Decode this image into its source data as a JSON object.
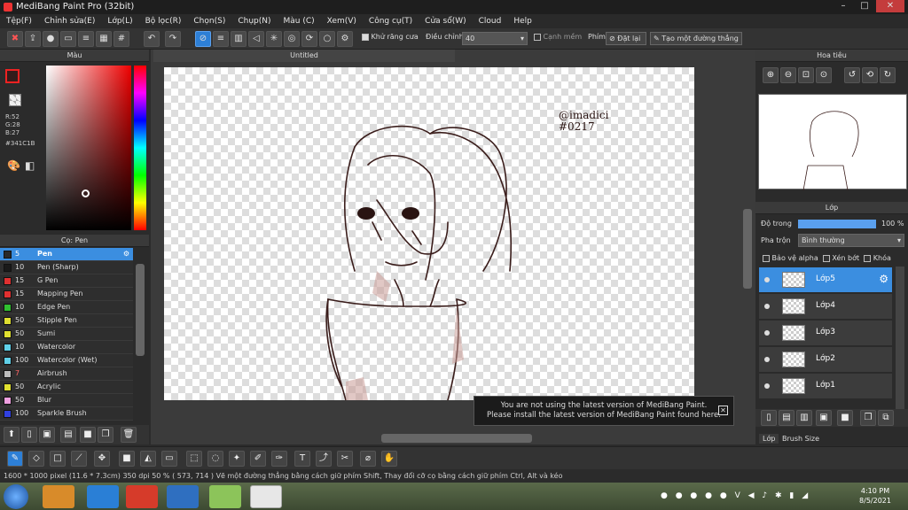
{
  "window": {
    "title": "MediBang Paint Pro (32bit)",
    "min": "–",
    "max": "□",
    "close": "✕"
  },
  "menu": [
    "Tệp(F)",
    "Chỉnh sửa(E)",
    "Lớp(L)",
    "Bộ lọc(R)",
    "Chọn(S)",
    "Chụp(N)",
    "Màu (C)",
    "Xem(V)",
    "Công cụ(T)",
    "Cửa sổ(W)",
    "Cloud",
    "Help"
  ],
  "toolbar": {
    "antialias_label": "Khử răng cưa",
    "adjust_label": "Điều chỉnh",
    "adjust_value": "40",
    "edge_label": "Cạnh mềm",
    "key_label": "Phím",
    "reset_label": "Đặt lại",
    "straight_label": "Tạo một đường thẳng"
  },
  "color_panel": {
    "title": "Màu",
    "r": "R:52",
    "g": "G:28",
    "b": "B:27",
    "hex": "#341C1B",
    "main_color": "#341C1B"
  },
  "brush_panel": {
    "title": "Cọ: Pen",
    "brushes": [
      {
        "size": "5",
        "name": "Pen",
        "color": "#2a2a2a",
        "selected": true
      },
      {
        "size": "10",
        "name": "Pen (Sharp)",
        "color": "#1a1a1a"
      },
      {
        "size": "15",
        "name": "G Pen",
        "color": "#e03030"
      },
      {
        "size": "15",
        "name": "Mapping Pen",
        "color": "#e03030"
      },
      {
        "size": "10",
        "name": "Edge Pen",
        "color": "#30c030"
      },
      {
        "size": "50",
        "name": "Stipple Pen",
        "color": "#e0e030"
      },
      {
        "size": "50",
        "name": "Sumi",
        "color": "#e0e030"
      },
      {
        "size": "10",
        "name": "Watercolor",
        "color": "#60d0e8"
      },
      {
        "size": "100",
        "name": "Watercolor (Wet)",
        "color": "#60d0e8"
      },
      {
        "size": "7",
        "name": "Airbrush",
        "color": "#bbbbbb"
      },
      {
        "size": "50",
        "name": "Acrylic",
        "color": "#e0e030"
      },
      {
        "size": "50",
        "name": "Blur",
        "color": "#f0a0e0"
      },
      {
        "size": "100",
        "name": "Sparkle Brush",
        "color": "#3040e0"
      }
    ]
  },
  "document": {
    "tab": "Untitled",
    "signature": "@imadici #0217"
  },
  "notice": {
    "line1": "You are not using the latest version of MediBang Paint.",
    "line2": "Please install the latest version of MediBang Paint found here."
  },
  "navigator": {
    "title": "Hoa tiêu"
  },
  "layer_panel": {
    "title": "Lớp",
    "opacity_label": "Độ trong",
    "opacity_value": "100 %",
    "opacity_fraction": 1.0,
    "blend_label": "Pha trộn",
    "blend_value": "Bình thường",
    "protect_alpha": "Bảo vệ alpha",
    "clip": "Xén bớt",
    "lock": "Khóa",
    "layers": [
      "Lớp5",
      "Lớp4",
      "Lớp3",
      "Lớp2",
      "Lớp1"
    ]
  },
  "right_tabs": [
    "Lớp",
    "Brush Size"
  ],
  "status": {
    "size": "1600 * 1000 pixel",
    "cm": "(11.6 * 7.3cm)",
    "dpi": "350 dpi",
    "zoom": "50 %",
    "coord": "( 573, 714 )",
    "hint": "Vẽ một đường thẳng bằng cách giữ phím Shift, Thay đổi cỡ cọ bằng cách giữ phím Ctrl, Alt và kéo"
  },
  "taskbar": {
    "time": "4:10 PM",
    "date": "8/5/2021"
  }
}
